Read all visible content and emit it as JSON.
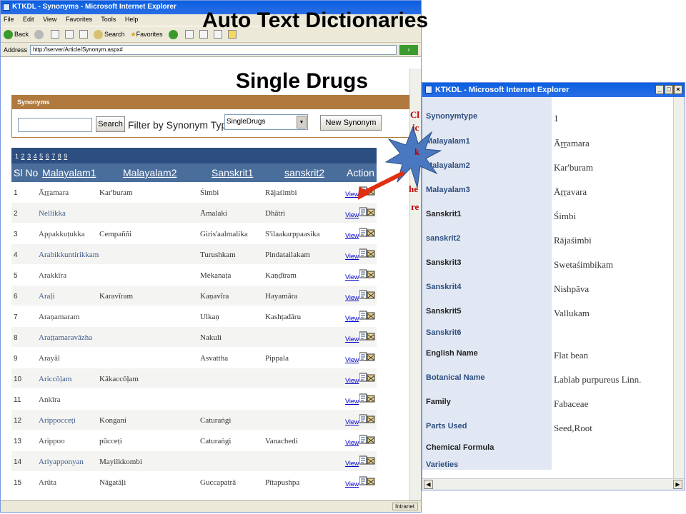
{
  "slide": {
    "title_main": "Auto Text Dictionaries",
    "title_sub": "Single Drugs",
    "annotation_lines": [
      "Cl",
      "ic",
      "k",
      "he",
      "re"
    ]
  },
  "main_window": {
    "title": "KTKDL - Synonyms - Microsoft Internet Explorer",
    "menu": [
      "File",
      "Edit",
      "View",
      "Favorites",
      "Tools",
      "Help"
    ],
    "toolbar": {
      "back": "Back",
      "search": "Search",
      "favorites": "Favorites"
    },
    "address_label": "Address",
    "address_url": "http://server/Article/Synonym.aspx#",
    "status_zone": "Intranet"
  },
  "synonyms": {
    "panel_title": "Synonyms",
    "search_value": "",
    "search_button": "Search",
    "filter_label": "Filter by Synonym Type",
    "filter_selected": "SingleDrugs",
    "new_button": "New Synonym",
    "pager": [
      "1",
      "2",
      "3",
      "4",
      "5",
      "6",
      "7",
      "8",
      "9"
    ],
    "columns": [
      "Sl No",
      "Malayalam1",
      "Malayalam2",
      "Sanskrit1",
      "sanskrit2",
      "Action"
    ],
    "view_label": "View",
    "rows": [
      {
        "no": "1",
        "m1": "Āṟṟamara",
        "m2": "Kar'buram",
        "s1": "Śimbi",
        "s2": "Rājaśimbi",
        "m1_link": false
      },
      {
        "no": "2",
        "m1": "Nellikka",
        "m2": "",
        "s1": "Āmalaki",
        "s2": "Dhātri",
        "m1_link": true
      },
      {
        "no": "3",
        "m1": "Appakkuṭukka",
        "m2": "Cempaññi",
        "s1": "Giris'aalmalika",
        "s2": "S'ilaakarppaasika",
        "m1_link": false
      },
      {
        "no": "4",
        "m1": "Arabikkuntirikkam",
        "m2": "",
        "s1": "Turushkam",
        "s2": "Pindatailakam",
        "m1_link": true
      },
      {
        "no": "5",
        "m1": "Arakkīra",
        "m2": "",
        "s1": "Mekanaṭa",
        "s2": "Kaṇḍīram",
        "m1_link": false
      },
      {
        "no": "6",
        "m1": "Araḷi",
        "m2": "Karavīram",
        "s1": "Kaṇavīra",
        "s2": "Hayamāra",
        "m1_link": true
      },
      {
        "no": "7",
        "m1": "Araṇamaram",
        "m2": "",
        "s1": "Ulkaṇ",
        "s2": "Kashṭadāru",
        "m1_link": false
      },
      {
        "no": "8",
        "m1": "Araṭṭamaravāzha",
        "m2": "",
        "s1": "Nakuli",
        "s2": "",
        "m1_link": true
      },
      {
        "no": "9",
        "m1": "Arayāl",
        "m2": "",
        "s1": "Asvattha",
        "s2": "Pippala",
        "m1_link": false
      },
      {
        "no": "10",
        "m1": "Ariccōḷam",
        "m2": "Kākaccōḷam",
        "s1": "",
        "s2": "",
        "m1_link": true
      },
      {
        "no": "11",
        "m1": "Ankīra",
        "m2": "",
        "s1": "",
        "s2": "",
        "m1_link": false
      },
      {
        "no": "12",
        "m1": "Arippocceṭi",
        "m2": "Kongani",
        "s1": "Caturaṅgi",
        "s2": "",
        "m1_link": true
      },
      {
        "no": "13",
        "m1": "Arippoo",
        "m2": "pūcceṭi",
        "s1": "Caturaṅgi",
        "s2": "Vanachedi",
        "m1_link": false
      },
      {
        "no": "14",
        "m1": "Ariyapponyan",
        "m2": "Mayilkkombi",
        "s1": "",
        "s2": "",
        "m1_link": true
      },
      {
        "no": "15",
        "m1": "Arūta",
        "m2": "Nāgatāḷi",
        "s1": "Guccapatrā",
        "s2": "Pītapushpa",
        "m1_link": false
      }
    ]
  },
  "popup": {
    "title": "KTKDL - Microsoft Internet Explorer",
    "fields": [
      {
        "label": "Synonymtype",
        "value": "1",
        "dark": false
      },
      {
        "label": "Malayalam1",
        "value": "Āṟṟamara",
        "dark": false
      },
      {
        "label": "Malayalam2",
        "value": "Kar'buram",
        "dark": false
      },
      {
        "label": "Malayalam3",
        "value": "Āṟṟavara",
        "dark": false
      },
      {
        "label": "Sanskrit1",
        "value": "Śimbi",
        "dark": true
      },
      {
        "label": "sanskrit2",
        "value": "Rājaśimbi",
        "dark": false
      },
      {
        "label": "Sanskrit3",
        "value": "Swetaśimbikam",
        "dark": true
      },
      {
        "label": "Sanskrit4",
        "value": "Nishpāva",
        "dark": false
      },
      {
        "label": "Sanskrit5",
        "value": "Vallukam",
        "dark": true
      },
      {
        "label": "Sanskrit6",
        "value": "",
        "dark": false
      },
      {
        "label": "English Name",
        "value": "Flat bean",
        "dark": true
      },
      {
        "label": "Botanical Name",
        "value": "Lablab purpureus Linn.",
        "dark": false
      },
      {
        "label": "Family",
        "value": "Fabaceae",
        "dark": true
      },
      {
        "label": "Parts Used",
        "value": "Seed,Root",
        "dark": false
      },
      {
        "label": "Chemical Formula",
        "value": "",
        "dark": true
      },
      {
        "label": "Varieties",
        "value": "",
        "dark": false
      }
    ]
  },
  "colors": {
    "ie_title": "#0a5fe0",
    "panel_header": "#b07a3f",
    "grid_pager": "#2d4e80",
    "grid_header": "#4a6e9c",
    "starburst": "#4a78c0",
    "annotation_text": "#c00000",
    "arrow": "#e03010"
  }
}
